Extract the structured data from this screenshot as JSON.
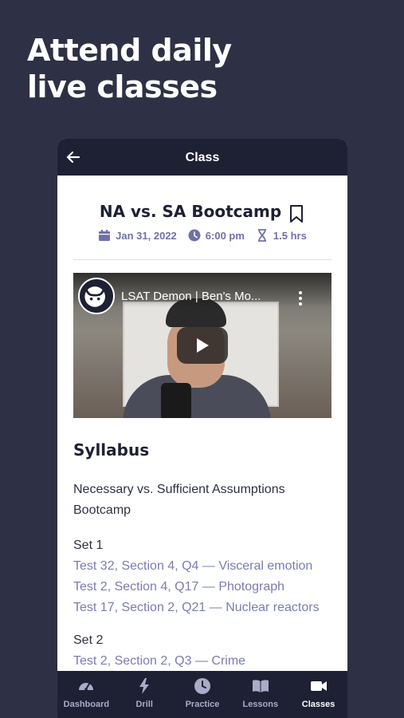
{
  "headline": {
    "line1": "Attend daily",
    "line2": "live classes"
  },
  "topbar": {
    "title": "Class",
    "back_icon": "arrow-left-icon"
  },
  "class": {
    "title": "NA vs. SA Bootcamp",
    "date": "Jan 31, 2022",
    "time": "6:00 pm",
    "duration": "1.5 hrs"
  },
  "video": {
    "title": "LSAT Demon | Ben's Mo..."
  },
  "syllabus": {
    "heading": "Syllabus",
    "description_line1": "Necessary vs. Sufficient Assumptions",
    "description_line2": "Bootcamp",
    "sets": [
      {
        "label": "Set 1",
        "items": [
          "Test 32, Section 4, Q4 — Visceral emotion",
          "Test 2, Section 4, Q17 — Photograph",
          "Test 17, Section 2, Q21 — Nuclear reactors"
        ]
      },
      {
        "label": "Set 2",
        "items": [
          "Test 2, Section 2, Q3 — Crime"
        ]
      }
    ]
  },
  "nav": {
    "items": [
      {
        "label": "Dashboard",
        "icon": "speedometer-icon"
      },
      {
        "label": "Drill",
        "icon": "lightning-icon"
      },
      {
        "label": "Practice",
        "icon": "clock-icon"
      },
      {
        "label": "Lessons",
        "icon": "book-icon"
      },
      {
        "label": "Classes",
        "icon": "video-camera-icon",
        "active": true
      }
    ]
  },
  "colors": {
    "background": "#2e3145",
    "nav": "#1e2034",
    "accent": "#7a7db2"
  }
}
